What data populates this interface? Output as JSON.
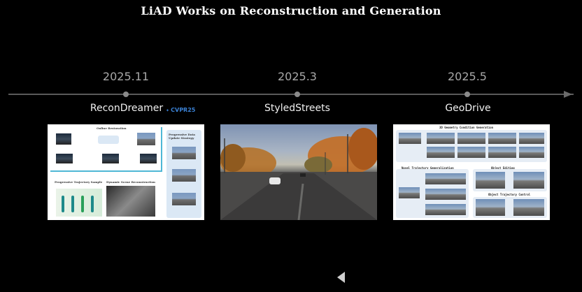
{
  "title": "LiAD Works on Reconstruction and Generation",
  "timeline": [
    {
      "date": "2025.11",
      "name": "ReconDreamer",
      "badge": "CVPR25",
      "figure_labels": {
        "online_restoration": "Online Restoration",
        "progressive_strategy": "Progressive Data Update Strategy",
        "progressive_sample": "Progressive Trajectory Sample",
        "dynamic_reconstruction": "Dynamic Scene Reconstruction"
      }
    },
    {
      "date": "2025.3",
      "name": "StyledStreets"
    },
    {
      "date": "2025.5",
      "name": "GeoDrive",
      "figure_labels": {
        "geometry_generation": "3D Geometry Condition Generation",
        "novel_trajectory": "Novel Trajectory Generalization",
        "object_editing": "Object Editing",
        "object_trajectory": "Object Trajectory Control"
      }
    }
  ],
  "colors": {
    "background": "#000000",
    "badge": "#3b82d6",
    "timeline": "#5a5a5a"
  },
  "icons": [
    "play-icon"
  ]
}
